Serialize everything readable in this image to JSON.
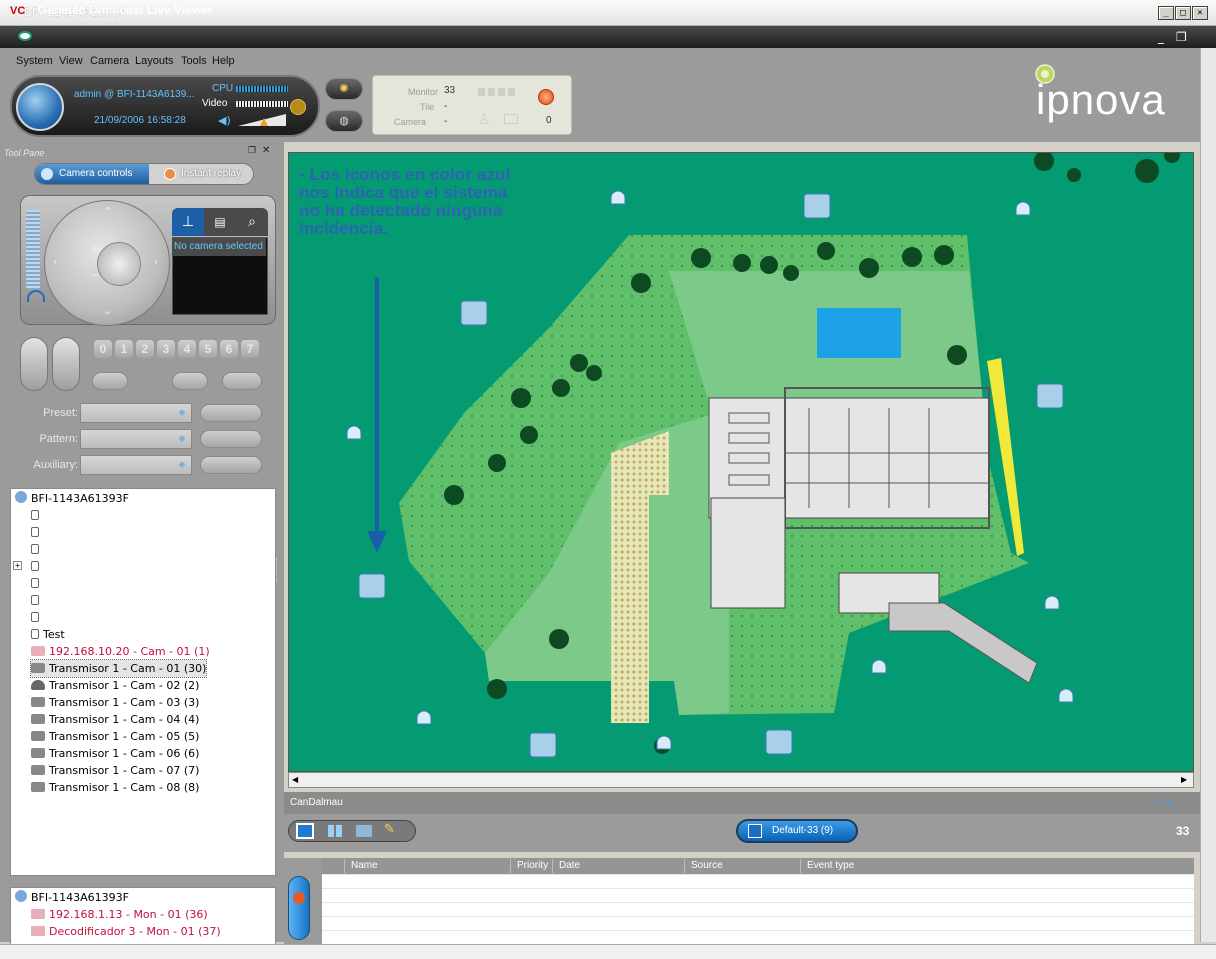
{
  "window": {
    "title": "BFI-1143A61393F",
    "logo": "VC",
    "min_glyph": "_",
    "max_glyph": "□",
    "close_glyph": "×"
  },
  "app": {
    "title": "Genetec Omnicast Live Viewer",
    "eye_icon": "eye-icon"
  },
  "menu": [
    "System",
    "View",
    "Camera",
    "Layouts",
    "Tools",
    "Help"
  ],
  "status": {
    "user": "admin @ BFI-1143A6139...",
    "datetime": "21/09/2006 16:58:28",
    "cpu_label": "CPU",
    "video_label": "Video",
    "alert_icon": "alert-icon"
  },
  "monitor": {
    "monitor_label": "Monitor",
    "monitor_value": "33",
    "tile_label": "Tile",
    "tile_value": "-",
    "camera_label": "Camera",
    "camera_value": "-",
    "alarm_count": "0"
  },
  "brand": {
    "logo_text": "ipnova"
  },
  "toolpane": {
    "title": "Tool Pane",
    "camera_controls": "Camera controls",
    "instant_replay": "Instant replay",
    "no_camera": "No camera selected",
    "numkeys": [
      "0",
      "1",
      "2",
      "3",
      "4",
      "5",
      "6",
      "7"
    ],
    "preset_label": "Preset:",
    "pattern_label": "Pattern:",
    "auxiliary_label": "Auxiliary:"
  },
  "tree": {
    "root": "BFI-1143A61393F",
    "items": [
      {
        "label": "",
        "type": "folder",
        "color": "#000000"
      },
      {
        "label": "",
        "type": "folder",
        "color": "#000000"
      },
      {
        "label": "",
        "type": "folder",
        "color": "#000000"
      },
      {
        "label": "",
        "type": "folder",
        "color": "#000000",
        "expandable": "+"
      },
      {
        "label": "",
        "type": "folder",
        "color": "#000000"
      },
      {
        "label": "",
        "type": "folder",
        "color": "#000000"
      },
      {
        "label": "",
        "type": "folder",
        "color": "#000000"
      },
      {
        "label": "Test",
        "type": "folder",
        "color": "#000000"
      },
      {
        "label": "192.168.10.20 - Cam - 01 (1)",
        "type": "camred",
        "color": "#c0103a"
      },
      {
        "label": "Transmisor 1 - Cam - 01 (30)",
        "type": "cam",
        "color": "#000000",
        "selected": true
      },
      {
        "label": "Transmisor 1 - Cam - 02 (2)",
        "type": "dome",
        "color": "#000000"
      },
      {
        "label": "Transmisor 1 - Cam - 03 (3)",
        "type": "cam",
        "color": "#000000"
      },
      {
        "label": "Transmisor 1 - Cam - 04 (4)",
        "type": "cam",
        "color": "#000000"
      },
      {
        "label": "Transmisor 1 - Cam - 05 (5)",
        "type": "cam",
        "color": "#000000"
      },
      {
        "label": "Transmisor 1 - Cam - 06 (6)",
        "type": "cam",
        "color": "#000000"
      },
      {
        "label": "Transmisor 1 - Cam - 07 (7)",
        "type": "cam",
        "color": "#000000"
      },
      {
        "label": "Transmisor 1 - Cam - 08 (8)",
        "type": "cam",
        "color": "#000000"
      }
    ]
  },
  "tree2": {
    "root": "BFI-1143A61393F",
    "items": [
      {
        "label": "192.168.1.13 - Mon - 01 (36)"
      },
      {
        "label": "Decodificador 3 - Mon - 01 (37)"
      }
    ]
  },
  "map": {
    "name": "CanDalmau",
    "annotation": [
      "- Los iconos en color azul",
      "nos indica que el sistema",
      "no ha detectado ninguna",
      "incidencia."
    ]
  },
  "tiles": {
    "default_label": "Default-33 (9)",
    "count": "33"
  },
  "events": {
    "columns": [
      "Name",
      "Priority",
      "Date",
      "Source",
      "Event type"
    ]
  },
  "colors": {
    "map_bg": "#049a72",
    "lawn": "#7cc98a",
    "accent_blue": "#2f62b5",
    "chrome": "#9a9b9a"
  }
}
